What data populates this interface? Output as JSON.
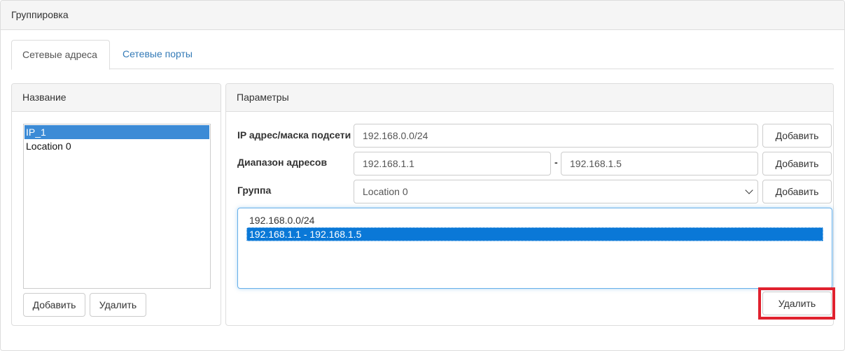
{
  "page": {
    "title": "Группировка"
  },
  "tabs": [
    {
      "label": "Сетевые адреса",
      "active": true
    },
    {
      "label": "Сетевые порты",
      "active": false
    }
  ],
  "left_panel": {
    "heading": "Название",
    "items": [
      {
        "label": "IP_1",
        "selected": true
      },
      {
        "label": "Location 0",
        "selected": false
      }
    ],
    "add_label": "Добавить",
    "delete_label": "Удалить"
  },
  "right_panel": {
    "heading": "Параметры",
    "subnet": {
      "label": "IP адрес/маска подсети",
      "value": "192.168.0.0/24",
      "add_label": "Добавить"
    },
    "range": {
      "label": "Диапазон адресов",
      "from": "192.168.1.1",
      "separator": "-",
      "to": "192.168.1.5",
      "add_label": "Добавить"
    },
    "group": {
      "label": "Группа",
      "selected": "Location 0",
      "add_label": "Добавить"
    },
    "entries": [
      {
        "label": "192.168.0.0/24",
        "selected": false
      },
      {
        "label": "192.168.1.1 - 192.168.1.5",
        "selected": true
      }
    ],
    "delete_label": "Удалить"
  },
  "colors": {
    "link": "#337ab7",
    "selection_left": "#3c8bd6",
    "selection_right": "#0a78d7",
    "highlight": "#e0212e",
    "focus_border": "#66afe9"
  },
  "icons": {
    "select_caret": "chevron-down-icon"
  }
}
